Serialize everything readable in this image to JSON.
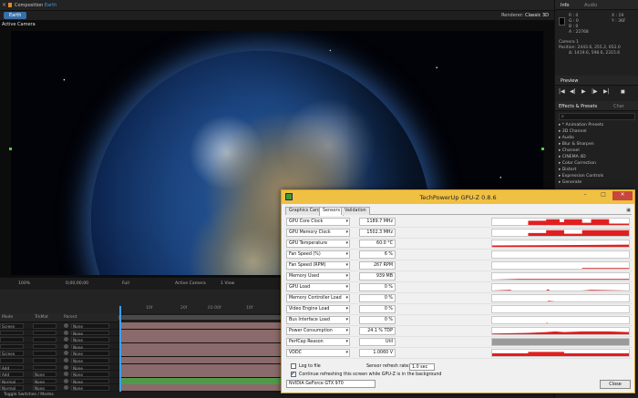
{
  "composition": {
    "header_prefix": "Composition",
    "header_name": "Earth",
    "tab": "Earth",
    "renderer_label": "Renderer:",
    "renderer_value": "Classic 3D",
    "active_camera": "Active Camera"
  },
  "info_panel": {
    "tab_info": "Info",
    "tab_audio": "Audio",
    "r": "R : 0",
    "g": "G : 0",
    "b": "B : 0",
    "a": "A : 22768",
    "x": "X : 19",
    "y": "Y : 36F",
    "camera": "Camera 1",
    "position": "Position: 2443.6, 255.2, 652.0",
    "delta": "Δ: 1419.6, 598.6, 2315.6"
  },
  "preview_panel": {
    "title": "Preview",
    "controls": [
      "|◀",
      "◀|",
      "▶",
      "|▶",
      "▶|",
      "■"
    ]
  },
  "effects_panel": {
    "tab_effects": "Effects & Presets",
    "tab_char": "Char",
    "search_placeholder": "",
    "items": [
      "▸ * Animation Presets",
      "▸ 3D Channel",
      "▸ Audio",
      "▸ Blur & Sharpen",
      "▸ Channel",
      "▸ CINEMA 4D",
      "▸ Color Correction",
      "▸ Distort",
      "▸ Expression Controls",
      "▸ Generate"
    ]
  },
  "timeline": {
    "zoom": "100%",
    "timecode": "0;00;00;00",
    "quality": "Full",
    "camera": "Active Camera",
    "views": "1 View",
    "col_mode": "Mode",
    "col_trkmat": "TrkMat",
    "col_parent": "Parent",
    "ruler": [
      "10f",
      "20f",
      "01:00f",
      "10f"
    ],
    "footer": "Toggle Switches / Modes",
    "layers": [
      {
        "mode": "Screen",
        "trk": "",
        "parent": "None",
        "color": "#8a6a6a"
      },
      {
        "mode": "",
        "trk": "",
        "parent": "None",
        "color": "#8a6a6a"
      },
      {
        "mode": "",
        "trk": "",
        "parent": "None",
        "color": "#8a6a6a"
      },
      {
        "mode": "",
        "trk": "",
        "parent": "None",
        "color": "#8a6a6a"
      },
      {
        "mode": "Screen",
        "trk": "",
        "parent": "None",
        "color": "#8a6a6a"
      },
      {
        "mode": "",
        "trk": "",
        "parent": "None",
        "color": "#8a6a6a"
      },
      {
        "mode": "Add",
        "trk": "",
        "parent": "None",
        "color": "#8a6a6a"
      },
      {
        "mode": "Add",
        "trk": "None",
        "parent": "None",
        "color": "#8a6a6a"
      },
      {
        "mode": "Normal",
        "trk": "None",
        "parent": "None",
        "color": "#4f9a4a"
      },
      {
        "mode": "Normal",
        "trk": "None",
        "parent": "None",
        "color": "#8a6a6a"
      }
    ]
  },
  "gpuz": {
    "title": "TechPowerUp GPU-Z 0.8.6",
    "tabs": [
      "Graphics Card",
      "Sensors",
      "Validation"
    ],
    "active_tab": "Sensors",
    "sensors": [
      {
        "label": "GPU Core Clock",
        "value": "1189.7 MHz"
      },
      {
        "label": "GPU Memory Clock",
        "value": "1502.3 MHz"
      },
      {
        "label": "GPU Temperature",
        "value": "60.0 °C"
      },
      {
        "label": "Fan Speed (%)",
        "value": "6 %"
      },
      {
        "label": "Fan Speed (RPM)",
        "value": "267 RPM"
      },
      {
        "label": "Memory Used",
        "value": "939 MB"
      },
      {
        "label": "GPU Load",
        "value": "0 %"
      },
      {
        "label": "Memory Controller Load",
        "value": "0 %"
      },
      {
        "label": "Video Engine Load",
        "value": "0 %"
      },
      {
        "label": "Bus Interface Load",
        "value": "0 %"
      },
      {
        "label": "Power Consumption",
        "value": "24.1 % TDP"
      },
      {
        "label": "PerfCap Reason",
        "value": "Util"
      },
      {
        "label": "VDDC",
        "value": "1.0060 V"
      }
    ],
    "log_to_file": "Log to file",
    "sensor_refresh_label": "Sensor refresh rate:",
    "sensor_refresh_value": "1.0 sec",
    "continue_refresh": "Continue refreshing this screen while GPU-Z is in the background",
    "gpu_name": "NVIDIA GeForce GTX 970",
    "close": "Close",
    "accent": "#f0c043",
    "graph_color": "#e02020"
  }
}
